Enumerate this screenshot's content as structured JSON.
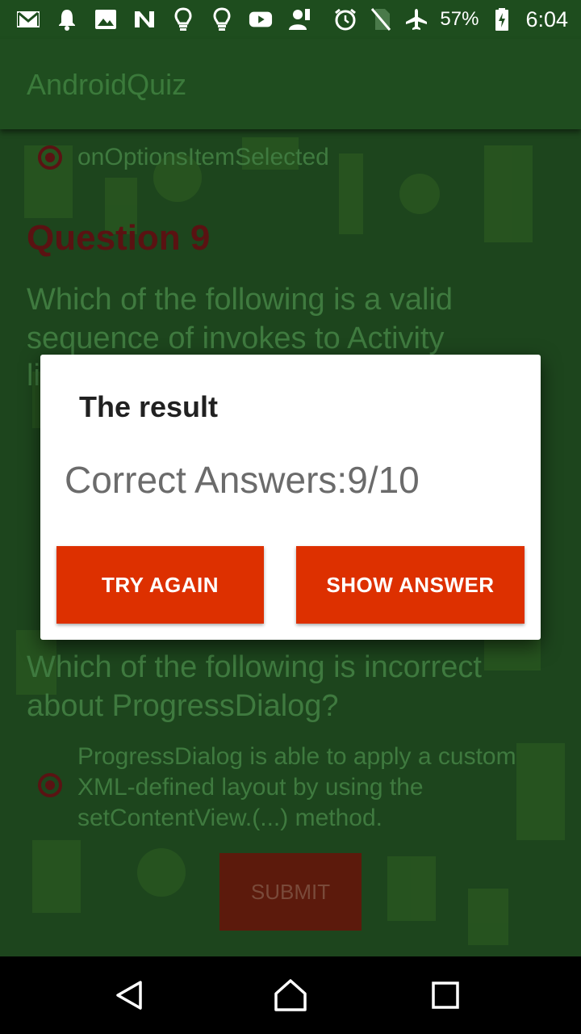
{
  "status_bar": {
    "left_icons": [
      "gmail-icon",
      "notification-bell-icon",
      "image-icon",
      "n-app-icon",
      "lightbulb-icon",
      "lightbulb-outline-icon",
      "youtube-icon",
      "person-icon"
    ],
    "right_icons": [
      "alarm-icon",
      "no-sim-icon",
      "airplane-icon",
      "battery-icon"
    ],
    "battery": "57%",
    "time": "6:04"
  },
  "app_bar": {
    "title": "AndroidQuiz"
  },
  "quiz": {
    "prev_option": "onOptionsItemSelected",
    "question9_heading": "Question 9",
    "question9_line1": "Which of the following is a valid",
    "question9_line2": "sequence of invokes to Activity",
    "question9_line3": "li",
    "question10_line1": "Which of the following is incorrect",
    "question10_line2": "about ProgressDialog?",
    "option_line1": "ProgressDialog is able to apply a custom",
    "option_line2": "XML-defined layout by using the",
    "option_line3": "setContentView.(...) method.",
    "submit_label": "SUBMIT"
  },
  "dialog": {
    "title": "The result",
    "message": "Correct Answers:9/10",
    "try_again_label": "TRY AGAIN",
    "show_answer_label": "SHOW ANSWER"
  },
  "colors": {
    "status_bar": "#1e4d1e",
    "app_bar": "#1f4d1f",
    "dim_background": "#1d451d",
    "dialog_button": "#dd3000",
    "dialog_title": "#212121",
    "dialog_message": "#6b6b6b"
  }
}
